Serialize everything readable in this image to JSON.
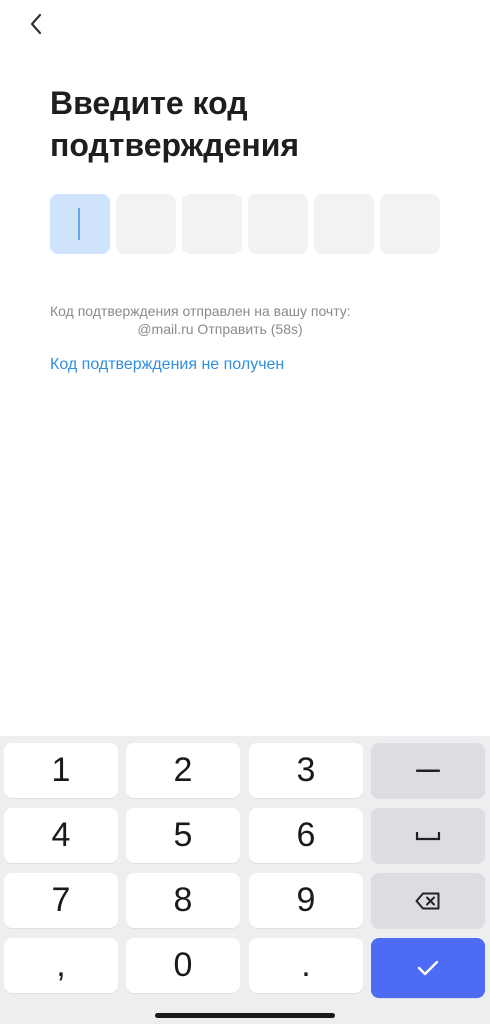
{
  "header": {
    "back_icon": "chevron-left-icon"
  },
  "page": {
    "title": "Введите код подтверждения"
  },
  "code_input": {
    "length": 6,
    "active_index": 0,
    "digits": [
      "",
      "",
      "",
      "",
      "",
      ""
    ]
  },
  "info": {
    "line1": "Код подтверждения отправлен на вашу почту:",
    "line2": "@mail.ru Отправить (58s)"
  },
  "link": {
    "not_received": "Код подтверждения не получен"
  },
  "keyboard": {
    "keys": {
      "k1": "1",
      "k2": "2",
      "k3": "3",
      "k4": "4",
      "k5": "5",
      "k6": "6",
      "k7": "7",
      "k8": "8",
      "k9": "9",
      "comma": ",",
      "k0": "0",
      "dot": "."
    },
    "func_icons": [
      "minus-icon",
      "space-icon",
      "backspace-icon",
      "check-icon"
    ],
    "colors": {
      "keyboard_bg": "#edeef0",
      "func_key": "#dcdde1",
      "confirm_key": "#4e6bf5",
      "link": "#2f8fe0"
    }
  }
}
